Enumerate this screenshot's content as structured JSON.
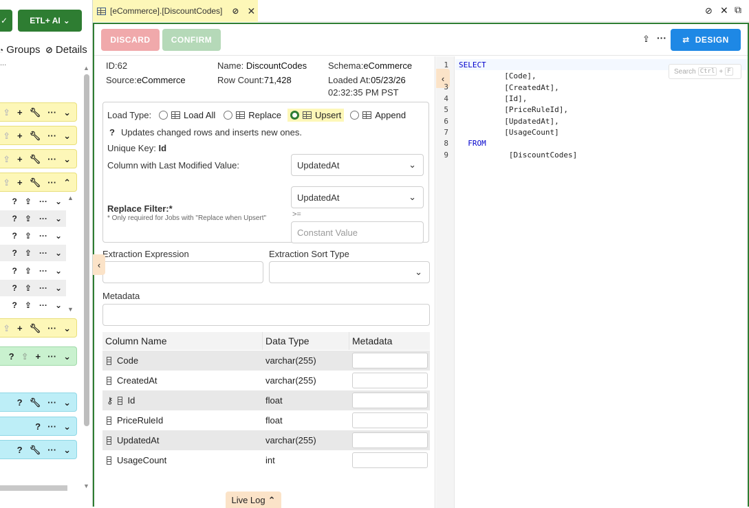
{
  "left": {
    "etl_button": "ETL+ AI",
    "groups_label": "Groups",
    "details_label": "Details",
    "ellipsis": "..."
  },
  "tab": {
    "title": "[eCommerce].[DiscountCodes]"
  },
  "toolbar": {
    "discard": "DISCARD",
    "confirm": "CONFIRM",
    "design": "DESIGN"
  },
  "info": {
    "id_label": "ID:",
    "id_value": "62",
    "name_label": "Name:",
    "name_value": "DiscountCodes",
    "schema_label": "Schema:",
    "schema_value": "eCommerce",
    "source_label": "Source:",
    "source_value": "eCommerce",
    "rowcount_label": "Row Count:",
    "rowcount_value": "71,428",
    "loaded_label": "Loaded At:",
    "loaded_value_1": "05/23/26",
    "loaded_value_2": "02:32:35 PM PST"
  },
  "load": {
    "label": "Load Type:",
    "options": [
      "Load All",
      "Replace",
      "Upsert",
      "Append"
    ],
    "selected": "Upsert",
    "hint": "Updates changed rows and inserts new ones.",
    "unique_key_label": "Unique Key:",
    "unique_key_value": "Id",
    "last_modified_label": "Column with Last Modified Value:",
    "last_modified_value": "UpdatedAt",
    "replace_filter_label": "Replace Filter:*",
    "replace_filter_note": "* Only required for Jobs with \"Replace when Upsert\"",
    "replace_filter_column": "UpdatedAt",
    "operator": ">=",
    "constant_placeholder": "Constant Value"
  },
  "extraction": {
    "expression_label": "Extraction Expression",
    "expression_value": "",
    "sort_label": "Extraction Sort Type",
    "sort_value": ""
  },
  "metadata": {
    "label": "Metadata",
    "value": ""
  },
  "columns": {
    "headers": [
      "Column Name",
      "Data Type",
      "Metadata"
    ],
    "rows": [
      {
        "name": "Code",
        "type": "varchar(255)",
        "key": false
      },
      {
        "name": "CreatedAt",
        "type": "varchar(255)",
        "key": false
      },
      {
        "name": "Id",
        "type": "float",
        "key": true
      },
      {
        "name": "PriceRuleId",
        "type": "float",
        "key": false
      },
      {
        "name": "UpdatedAt",
        "type": "varchar(255)",
        "key": false
      },
      {
        "name": "UsageCount",
        "type": "int",
        "key": false
      }
    ]
  },
  "editor": {
    "search_label": "Search",
    "search_shortcut_1": "Ctrl",
    "search_shortcut_2": "F",
    "lines": [
      {
        "n": "1",
        "text": "SELECT"
      },
      {
        "n": "3",
        "text": "          [Code],"
      },
      {
        "n": "",
        "text": "          [CreatedAt],"
      },
      {
        "n": "4",
        "text": "          [Id],"
      },
      {
        "n": "5",
        "text": "          [PriceRuleId],"
      },
      {
        "n": "6",
        "text": "          [UpdatedAt],"
      },
      {
        "n": "7",
        "text": "          [UsageCount]"
      },
      {
        "n": "8",
        "text": "  FROM"
      },
      {
        "n": "9",
        "text": "           [DiscountCodes]"
      }
    ]
  },
  "live_log": "Live Log",
  "colors": {
    "accent_green": "#2e7d32",
    "design_blue": "#1e88e5",
    "discard_red": "#f0a9ab",
    "confirm_green": "#b5d9b8",
    "tab_yellow": "#fdf7b8"
  }
}
